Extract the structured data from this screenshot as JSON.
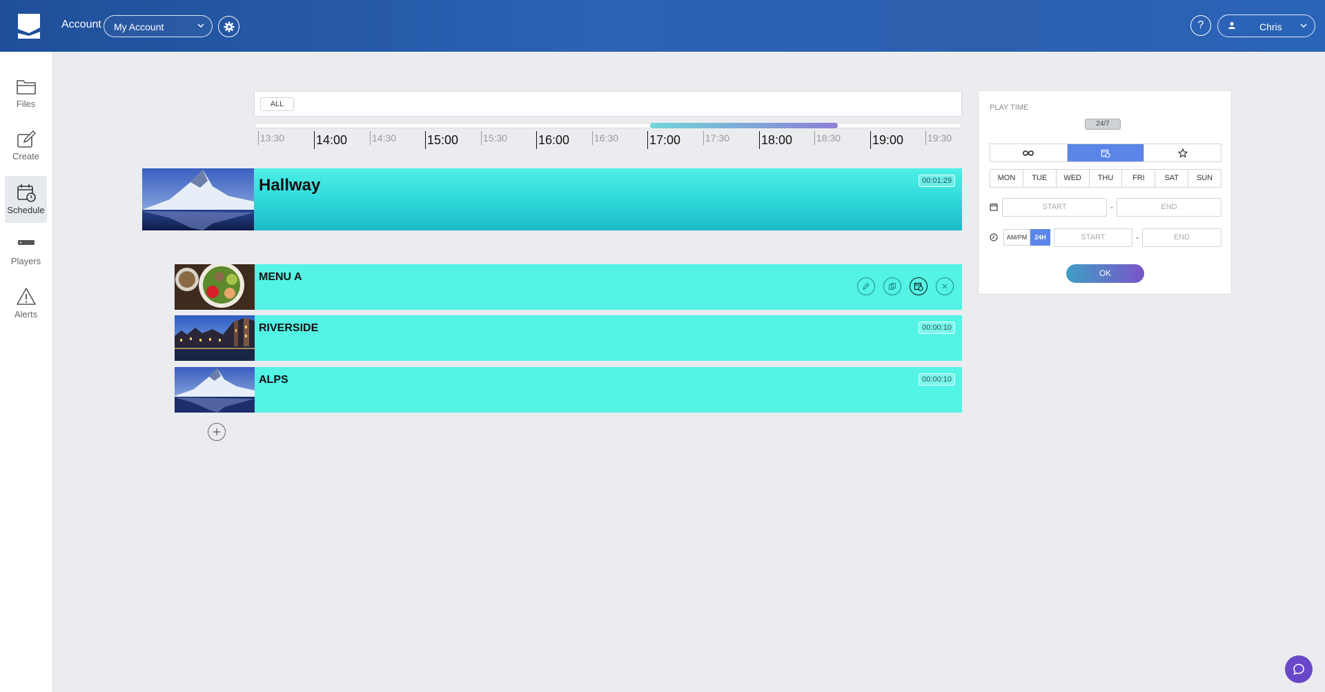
{
  "header": {
    "account_label": "Account",
    "account_select": "My Account",
    "help_label": "?",
    "user_name": "Chris"
  },
  "sidebar": {
    "items": [
      {
        "label": "Files",
        "icon": "folder-icon"
      },
      {
        "label": "Create",
        "icon": "create-icon"
      },
      {
        "label": "Schedule",
        "icon": "schedule-icon",
        "active": true
      },
      {
        "label": "Players",
        "icon": "player-icon"
      },
      {
        "label": "Alerts",
        "icon": "alert-icon"
      }
    ]
  },
  "timeline": {
    "filter_chip": "ALL",
    "ticks": [
      "13:30",
      "14:00",
      "14:30",
      "15:00",
      "15:30",
      "16:00",
      "16:30",
      "17:00",
      "17:30",
      "18:00",
      "18:30",
      "19:00",
      "19:30"
    ]
  },
  "playlists": [
    {
      "title": "Hallway",
      "duration": "00:01:29"
    },
    {
      "title": "MENU A",
      "duration": ""
    },
    {
      "title": "RIVERSIDE",
      "duration": "00:00:10"
    },
    {
      "title": "ALPS",
      "duration": "00:00:10"
    }
  ],
  "playtime": {
    "title": "PLAY TIME",
    "badge": "24/7",
    "days": [
      "MON",
      "TUE",
      "WED",
      "THU",
      "FRI",
      "SAT",
      "SUN"
    ],
    "date_start": "START",
    "date_end": "END",
    "time_start": "START",
    "time_end": "END",
    "dash": "-",
    "ampm": "AM/PM",
    "h24": "24H",
    "ok": "OK"
  },
  "colors": {
    "header": "#2b62b3",
    "row": "#53f3e5",
    "accent": "#5b86e8"
  }
}
